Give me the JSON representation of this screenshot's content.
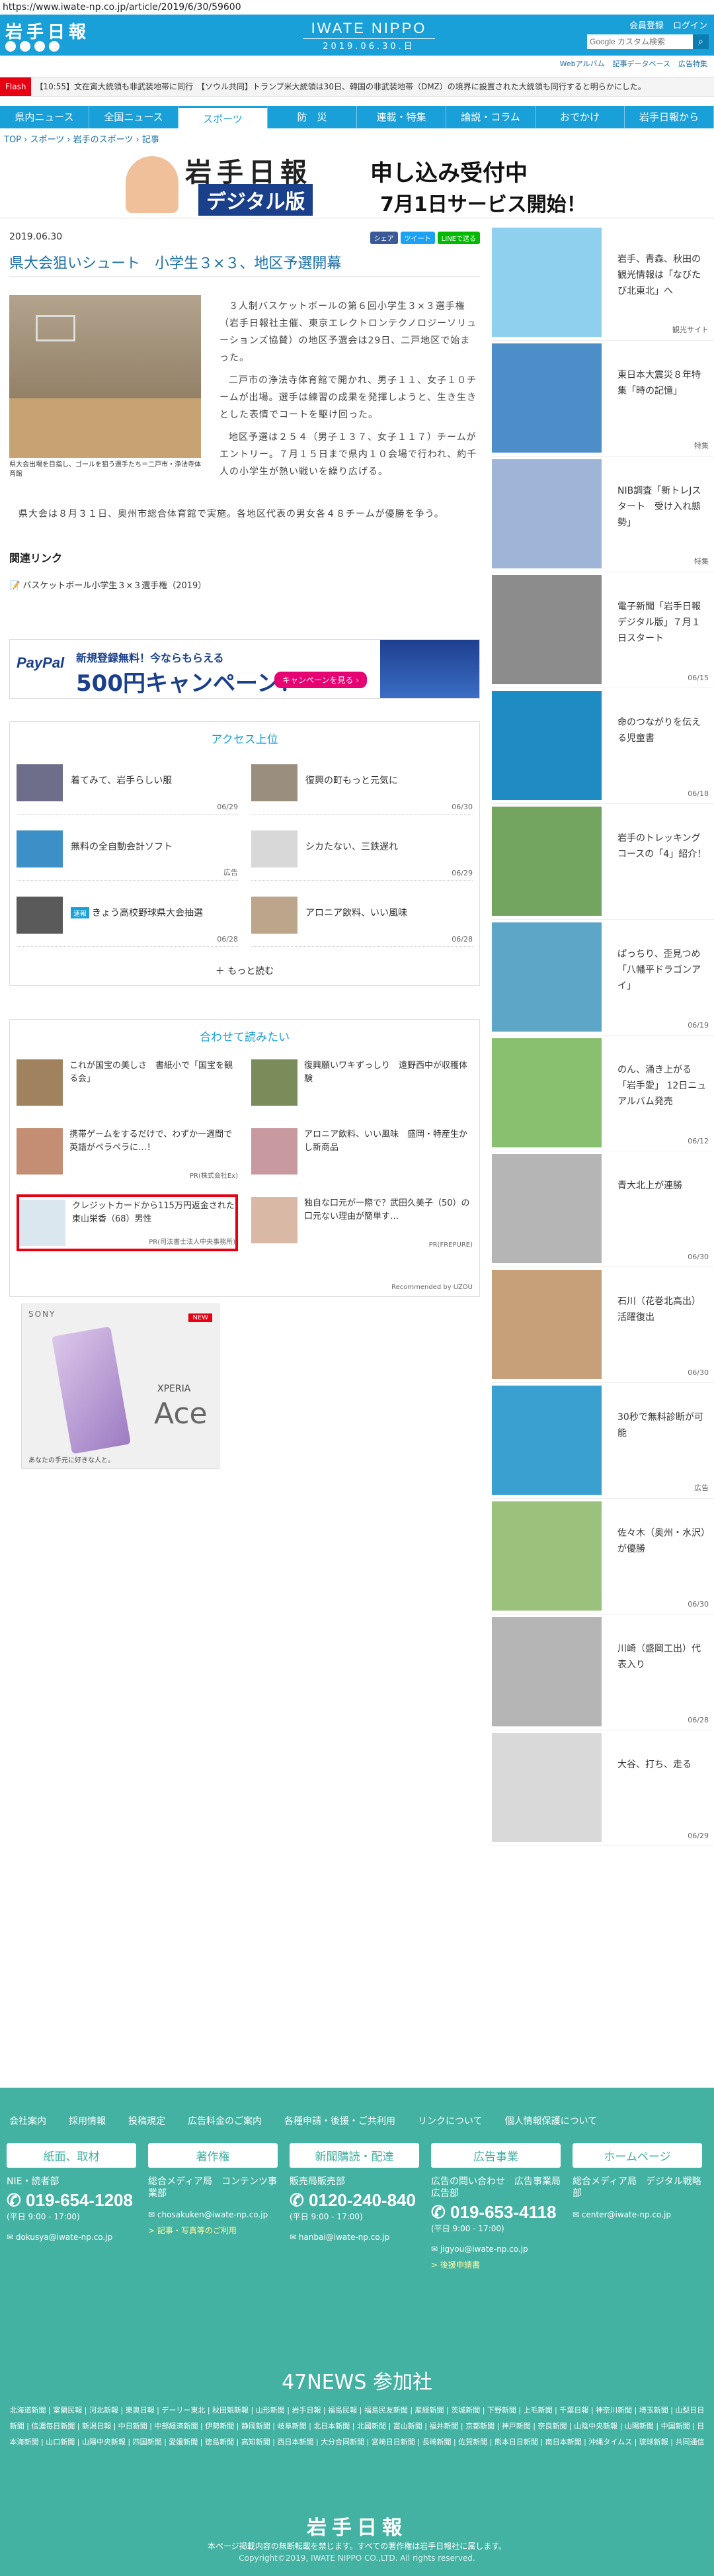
{
  "url": "https://www.iwate-np.co.jp/article/2019/6/30/59600",
  "header": {
    "logo": "岩手日報",
    "brand": "IWATE NIPPO",
    "date": "2019.06.30.日",
    "links": [
      "会員登録",
      "ログイン"
    ],
    "search_placeholder": "Google カスタム検索",
    "sublinks": [
      "Webアルバム",
      "記事データベース",
      "広告特集"
    ]
  },
  "flash": {
    "label": "Flash",
    "text": "【10:55】文在寅大統領も非武装地帯に同行　【ソウル共同】トランプ米大統領は30日、韓国の非武装地帯（DMZ）の境界に設置された大統領も同行すると明らかにした。"
  },
  "nav": [
    "県内ニュース",
    "全国ニュース",
    "スポーツ",
    "防　災",
    "連載・特集",
    "論説・コラム",
    "おでかけ",
    "岩手日報から"
  ],
  "nav_active": 2,
  "breadcrumb": "TOP › スポーツ › 岩手のスポーツ › 記事",
  "banner": {
    "logo": "岩手日報",
    "digital": "デジタル版",
    "line1": "申し込み受付中",
    "line2": "7月1日サービス開始！"
  },
  "article": {
    "date": "2019.06.30",
    "share": [
      "シェア",
      "ツイート",
      "LINEで送る"
    ],
    "title": "県大会狙いシュート　小学生３×３、地区予選開幕",
    "caption": "県大会出場を目指し、ゴールを狙う選手たち＝二戸市・浄法寺体育館",
    "p1": "３人制バスケットボールの第６回小学生３×３選手権（岩手日報社主催、東京エレクトロンテクノロジーソリューションズ協賛）の地区予選会は29日、二戸地区で始まった。",
    "p2": "二戸市の浄法寺体育館で開かれ、男子１１、女子１０チームが出場。選手は練習の成果を発揮しようと、生き生きとした表情でコートを駆け回った。",
    "p3": "地区予選は２５４（男子１３７、女子１１７）チームがエントリー。７月１５日まで県内１０会場で行われ、約千人の小学生が熱い戦いを繰り広げる。",
    "p4": "県大会は８月３１日、奥州市総合体育館で実施。各地区代表の男女各４８チームが優勝を争う。",
    "related_heading": "関連リンク",
    "related_link": "バスケットボール小学生３×３選手権（2019）"
  },
  "paypal": {
    "logo": "PayPal",
    "line1": "新規登録無料！今ならもらえる",
    "line2": "500円キャンペーン！",
    "button": "キャンペーンを見る ›"
  },
  "access": {
    "heading": "アクセス上位",
    "items": [
      {
        "title": "着てみて、岩手らしい服",
        "date": "06/29",
        "tag": ""
      },
      {
        "title": "復興の町もっと元気に",
        "date": "06/30",
        "tag": ""
      },
      {
        "title": "無料の全自動会計ソフト",
        "date": "広告",
        "tag": ""
      },
      {
        "title": "シカたない、三鉄遅れ",
        "date": "06/29",
        "tag": ""
      },
      {
        "title": "きょう高校野球県大会抽選",
        "date": "06/28",
        "tag": "速報"
      },
      {
        "title": "アロニア飲料、いい風味",
        "date": "06/28",
        "tag": ""
      }
    ],
    "more": "もっと読む"
  },
  "recommend": {
    "heading": "合わせて読みたい",
    "items": [
      {
        "title": "これが国宝の美しさ　書紙小で「国宝を観る会」",
        "source": ""
      },
      {
        "title": "復興願いワキずっしり　遠野西中が収穫体験",
        "source": ""
      },
      {
        "title": "携帯ゲームをするだけで、わずか一週間で英語がペラペラに…！",
        "source": "PR(株式会社Ex)"
      },
      {
        "title": "アロニア飲料、いい風味　盛岡・特産生かし新商品",
        "source": ""
      },
      {
        "title": "クレジットカードから115万円返金された東山栄香（68）男性",
        "source": "PR(司法書士法人中央事務所)"
      },
      {
        "title": "独自な口元が一際で？武田久美子（50）の口元ない理由が簡単す…",
        "source": "PR(FREPURE)"
      }
    ],
    "credit": "Recommended by UZOU"
  },
  "ad_sony": {
    "brand": "SONY",
    "new": "NEW",
    "name": "XPERIA",
    "model": "Ace",
    "tagline": "あなたの手元に好きな人と。"
  },
  "sidebar": [
    {
      "title": "岩手、青森、秋田の観光情報は「なびたび北東北」へ",
      "date": "観光サイト",
      "color": "#8fd0ee"
    },
    {
      "title": "東日本大震災８年特集「時の記憶」",
      "date": "特集",
      "color": "#4d8ec9"
    },
    {
      "title": "NIB調査「新トレJスタート　受け入れ態勢」",
      "date": "特集",
      "color": "#9fb5d8"
    },
    {
      "title": "電子新聞「岩手日報デジタル版」７月１日スタート",
      "date": "06/15",
      "color": "#8c8c8c"
    },
    {
      "title": "命のつながりを伝える児童書",
      "date": "06/18",
      "color": "#1e8bc3"
    },
    {
      "title": "岩手のトレッキングコースの「4」紹介！",
      "date": "",
      "color": "#73a460"
    },
    {
      "title": "ぱっちり、歪見つめ「八幡平ドラゴンアイ」",
      "date": "06/19",
      "color": "#5ea6c8"
    },
    {
      "title": "のん、涌き上がる「岩手愛」 12日ニュアルバム発売",
      "date": "06/12",
      "color": "#88c070"
    },
    {
      "title": "青大北上が連勝",
      "date": "06/30",
      "color": "#b5b5b5"
    },
    {
      "title": "石川（花巻北高出）活躍復出",
      "date": "06/30",
      "color": "#c5a079"
    },
    {
      "title": "30秒で無料診断が可能",
      "date": "広告",
      "color": "#3aa0cf"
    },
    {
      "title": "佐々木（奥州・水沢）が優勝",
      "date": "06/30",
      "color": "#9ac27c"
    },
    {
      "title": "川崎（盛岡工出）代表入り",
      "date": "06/28",
      "color": "#b5b5b5"
    },
    {
      "title": "大谷、打ち、走る",
      "date": "06/29",
      "color": "#d9d9d9"
    }
  ],
  "footer": {
    "nav": [
      "会社案内",
      "採用情報",
      "投稿規定",
      "広告料金のご案内",
      "各種申請・後援・ご共利用",
      "リンクについて",
      "個人情報保護について"
    ],
    "cols": [
      {
        "head": "紙面、取材",
        "sub": "NIE・読者部",
        "tel": "019-654-1208",
        "hrs": "(平日 9:00 - 17:00)",
        "mail": "dokusya@iwate-np.co.jp",
        "extra": ""
      },
      {
        "head": "著作権",
        "sub": "総合メディア局　コンテンツ事業部",
        "tel": "",
        "hrs": "",
        "mail": "chosakuken@iwate-np.co.jp",
        "extra": "> 記事・写真等のご利用"
      },
      {
        "head": "新聞購読・配達",
        "sub": "販売局販売部",
        "tel": "0120-240-840",
        "hrs": "(平日 9:00 - 17:00)",
        "mail": "hanbai@iwate-np.co.jp",
        "extra": ""
      },
      {
        "head": "広告事業",
        "sub": "広告の問い合わせ　広告事業局広告部",
        "tel": "019-653-4118",
        "hrs": "(平日 9:00 - 17:00)",
        "mail": "jigyou@iwate-np.co.jp",
        "extra": "> 後援申請書"
      },
      {
        "head": "ホームページ",
        "sub": "総合メディア局　デジタル戦略部",
        "tel": "",
        "hrs": "",
        "mail": "center@iwate-np.co.jp",
        "extra": ""
      }
    ],
    "news47": "47NEWS 参加社",
    "papers": "北海道新聞 | 室蘭民報 | 河北新報 | 東奥日報 | デーリー東北 | 秋田魁新報 | 山形新聞 | 岩手日報 | 福島民報 | 福島民友新聞 | 産経新聞 | 茨城新聞 | 下野新聞 | 上毛新聞 | 千葉日報 | 神奈川新聞 | 埼玉新聞 | 山梨日日新聞 | 信濃毎日新聞 | 新潟日報 | 中日新聞 | 中部経済新聞 | 伊勢新聞 | 静岡新聞 | 岐阜新聞 | 北日本新聞 | 北國新聞 | 富山新聞 | 福井新聞 | 京都新聞 | 神戸新聞 | 奈良新聞 | 山陰中央新報 | 山陽新聞 | 中国新聞 | 日本海新聞 | 山口新聞 | 山陽中央新報 | 四国新聞 | 愛媛新聞 | 徳島新聞 | 高知新聞 | 西日本新聞 | 大分合同新聞 | 宮崎日日新聞 | 長崎新聞 | 佐賀新聞 | 熊本日日新聞 | 南日本新聞 | 沖縄タイムス | 琉球新報 | 共同通信",
    "logo": "岩手日報",
    "note": "本ページ掲載内容の無断転載を禁じます。すべての著作権は岩手日報社に属します。",
    "copyright": "Copyright©2019, IWATE NIPPO CO.,LTD. All rights reserved."
  }
}
